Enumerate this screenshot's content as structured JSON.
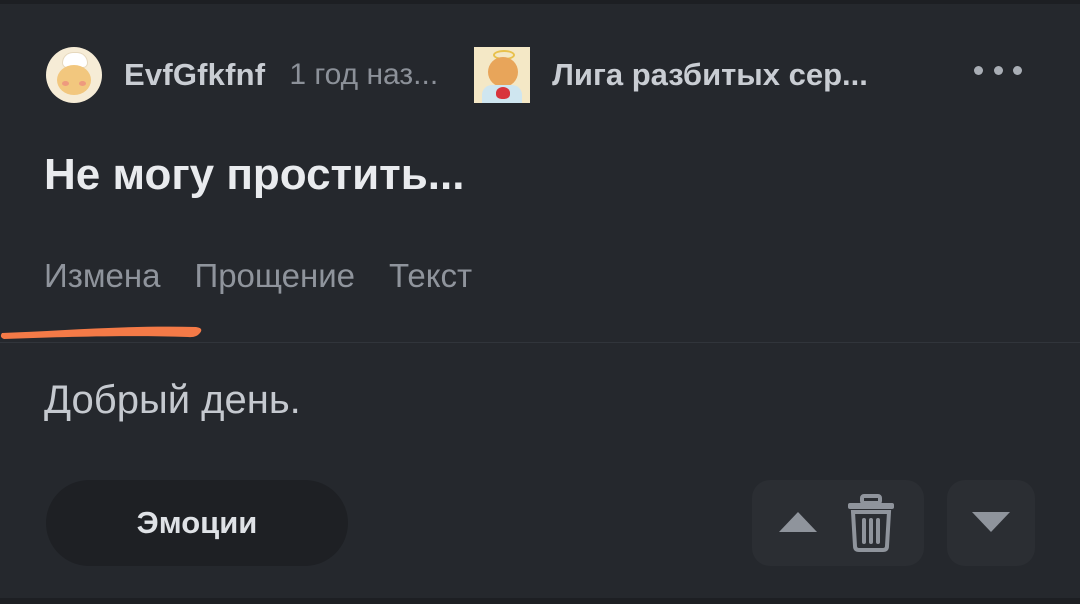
{
  "post": {
    "author": {
      "name": "EvfGfkfnf",
      "avatar_icon": "chef-avatar-icon"
    },
    "time": "1 год наз...",
    "community": {
      "name": "Лига разбитых сер...",
      "avatar_icon": "community-avatar-icon"
    },
    "title": "Не могу простить...",
    "tags": [
      "Измена",
      "Прощение",
      "Текст"
    ],
    "body": "Добрый день."
  },
  "actions": {
    "emotions_label": "Эмоции",
    "more_icon": "more-dots-icon",
    "upvote_icon": "upvote-triangle-icon",
    "delete_icon": "trash-icon",
    "downvote_icon": "downvote-triangle-icon"
  },
  "colors": {
    "background": "#25282d",
    "annotation_underline": "#f47a47",
    "button_bg": "#1e2024",
    "icon_gray": "#8f949c"
  }
}
